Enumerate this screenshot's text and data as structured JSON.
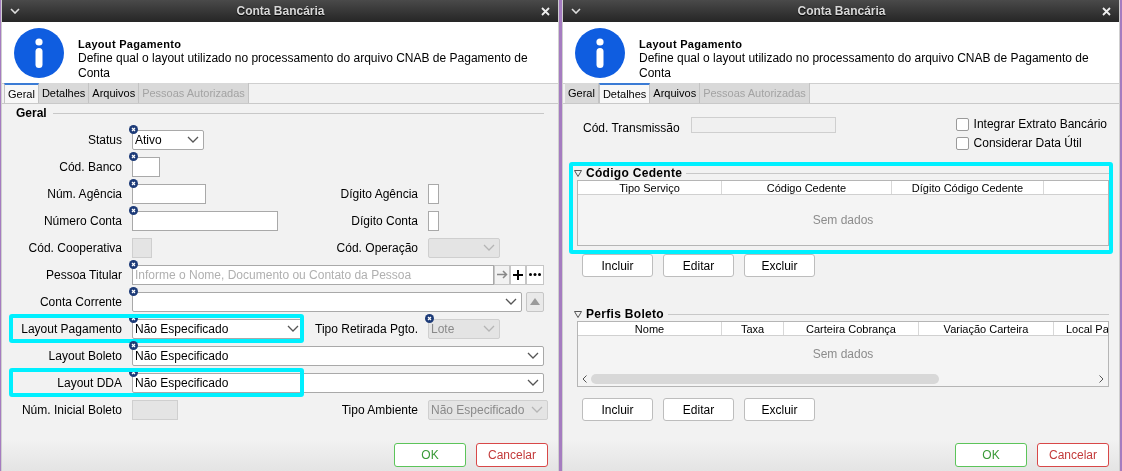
{
  "windows": [
    {
      "kind": "general",
      "title": "Conta Bancária",
      "info": {
        "title": "Layout Pagamento",
        "text": "Define qual o layout utilizado no processamento do arquivo CNAB de Pagamento de Conta"
      },
      "tabs": [
        {
          "label": "Geral",
          "selected": true,
          "disabled": false
        },
        {
          "label": "Detalhes",
          "selected": false,
          "disabled": false
        },
        {
          "label": "Arquivos",
          "selected": false,
          "disabled": false
        },
        {
          "label": "Pessoas Autorizadas",
          "selected": false,
          "disabled": true
        }
      ],
      "section": "Geral",
      "rows": [
        {
          "left": {
            "label": "Status",
            "kind": "combo",
            "value": "Ativo",
            "required": true,
            "disabled": false,
            "highlighted": false
          }
        },
        {
          "left": {
            "label": "Cód. Banco",
            "kind": "text",
            "required": true,
            "disabled": false,
            "highlighted": false
          }
        },
        {
          "left": {
            "label": "Núm. Agência",
            "kind": "text",
            "required": true,
            "disabled": false,
            "highlighted": false
          },
          "right": {
            "label": "Dígito Agência",
            "kind": "text",
            "required": false,
            "disabled": false
          }
        },
        {
          "left": {
            "label": "Número Conta",
            "kind": "text",
            "required": true,
            "disabled": false,
            "highlighted": false
          },
          "right": {
            "label": "Dígito Conta",
            "kind": "text",
            "required": false,
            "disabled": false
          }
        },
        {
          "left": {
            "label": "Cód. Cooperativa",
            "kind": "text",
            "required": false,
            "disabled": true,
            "highlighted": false
          },
          "right": {
            "label": "Cód. Operação",
            "kind": "combo",
            "required": false,
            "disabled": true
          }
        },
        {
          "left": {
            "label": "Pessoa Titular",
            "kind": "lookup",
            "placeholder": "Informe o Nome, Documento ou Contato da Pessoa",
            "required": true,
            "disabled": false,
            "highlighted": false
          }
        },
        {
          "left": {
            "label": "Conta Corrente",
            "kind": "combo-up",
            "required": true,
            "disabled": false,
            "highlighted": false
          }
        },
        {
          "left": {
            "label": "Layout Pagamento",
            "kind": "combo",
            "value": "Não Especificado",
            "required": true,
            "disabled": false,
            "highlighted": true
          },
          "right": {
            "label": "Tipo Retirada Pgto.",
            "kind": "combo",
            "value": "Lote",
            "required": true,
            "disabled": true
          }
        },
        {
          "left": {
            "label": "Layout Boleto",
            "kind": "combo",
            "value": "Não Especificado",
            "required": true,
            "disabled": false,
            "highlighted": false
          }
        },
        {
          "left": {
            "label": "Layout DDA",
            "kind": "combo",
            "value": "Não Especificado",
            "required": true,
            "disabled": false,
            "highlighted": true
          }
        },
        {
          "left": {
            "label": "Núm. Inicial Boleto",
            "kind": "text",
            "required": false,
            "disabled": true,
            "highlighted": false
          },
          "right": {
            "label": "Tipo Ambiente",
            "kind": "combo",
            "value": "Não Especificado",
            "required": false,
            "disabled": true
          }
        }
      ],
      "buttons": [
        {
          "label": "OK",
          "kind": "ok"
        },
        {
          "label": "Cancelar",
          "kind": "cancel"
        }
      ]
    },
    {
      "kind": "details",
      "title": "Conta Bancária",
      "info": {
        "title": "Layout Pagamento",
        "text": "Define qual o layout utilizado no processamento do arquivo CNAB de Pagamento de Conta"
      },
      "tabs": [
        {
          "label": "Geral",
          "selected": false,
          "disabled": false
        },
        {
          "label": "Detalhes",
          "selected": true,
          "disabled": false
        },
        {
          "label": "Arquivos",
          "selected": false,
          "disabled": false
        },
        {
          "label": "Pessoas Autorizadas",
          "selected": false,
          "disabled": true
        }
      ],
      "transmission": {
        "label": "Cód. Transmissão",
        "disabled": true
      },
      "checkboxes": [
        {
          "label": "Integrar Extrato Bancário",
          "checked": false
        },
        {
          "label": "Considerar Data Útil",
          "checked": false
        }
      ],
      "groups": [
        {
          "title": "Código Cedente",
          "expanded": true,
          "highlighted": true,
          "columns": [
            "Tipo Serviço",
            "Código Cedente",
            "Dígito Código Cedente",
            ""
          ],
          "empty": "Sem dados",
          "scrollbar": false,
          "buttons": [
            "Incluir",
            "Editar",
            "Excluir"
          ]
        },
        {
          "title": "Perfis Boleto",
          "expanded": true,
          "highlighted": false,
          "columns": [
            "Nome",
            "Taxa",
            "Carteira Cobrança",
            "Variação Carteira",
            "Local Pa"
          ],
          "empty": "Sem dados",
          "scrollbar": true,
          "buttons": [
            "Incluir",
            "Editar",
            "Excluir"
          ]
        }
      ],
      "buttons": [
        {
          "label": "OK",
          "kind": "ok"
        },
        {
          "label": "Cancelar",
          "kind": "cancel"
        }
      ]
    }
  ]
}
